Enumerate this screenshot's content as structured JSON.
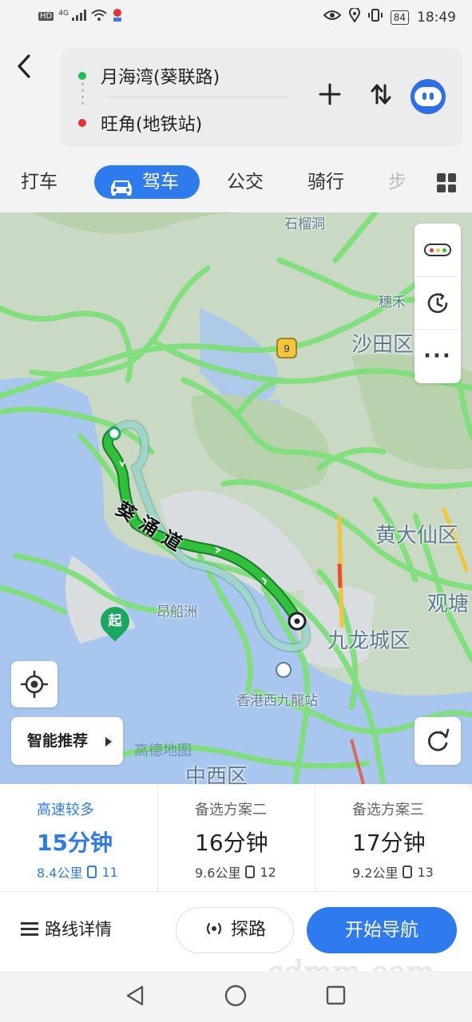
{
  "status_bar": {
    "left_icons": [
      "hd-icon",
      "4g-signal-icon",
      "wifi-icon",
      "location-app-icon"
    ],
    "hd": "HD",
    "net": "4G",
    "battery": "84",
    "time": "18:49"
  },
  "route": {
    "from": "月海湾(葵联路)",
    "to": "旺角(地铁站)"
  },
  "tabs": [
    {
      "label": "打车"
    },
    {
      "label": "驾车"
    },
    {
      "label": "公交"
    },
    {
      "label": "骑行"
    },
    {
      "label": "步行"
    }
  ],
  "map": {
    "labels": {
      "shek_lei": "石榴洞",
      "sui_wo": "穗禾",
      "sha_tin": "沙田区",
      "wong_tai_sin": "黄大仙区",
      "kwun_tong": "观塘",
      "stonecutters": "昂船洲",
      "kowloon_city": "九龙城区",
      "west_kowloon": "香港西九龍站",
      "central_western": "中西区",
      "route9": "9"
    },
    "road_name": "葵涌道",
    "start_marker": "起",
    "end_marker": "终",
    "logo": "高德地图",
    "smart_recommend": "智能推荐"
  },
  "plans": [
    {
      "title": "高速较多",
      "time": "15分钟",
      "distance": "8.4公里",
      "lights": "11"
    },
    {
      "title": "备选方案二",
      "time": "16分钟",
      "distance": "9.6公里",
      "lights": "12"
    },
    {
      "title": "备选方案三",
      "time": "17分钟",
      "distance": "9.2公里",
      "lights": "13"
    }
  ],
  "actions": {
    "route_detail": "路线详情",
    "explore": "探路",
    "start_nav": "开始导航"
  },
  "watermark": "gdmm.com",
  "colors": {
    "accent": "#2e7bf0",
    "route_main": "#27b73a",
    "route_alt": "#8fc9bf",
    "start": "#1aa860",
    "end": "#e93a3a"
  }
}
